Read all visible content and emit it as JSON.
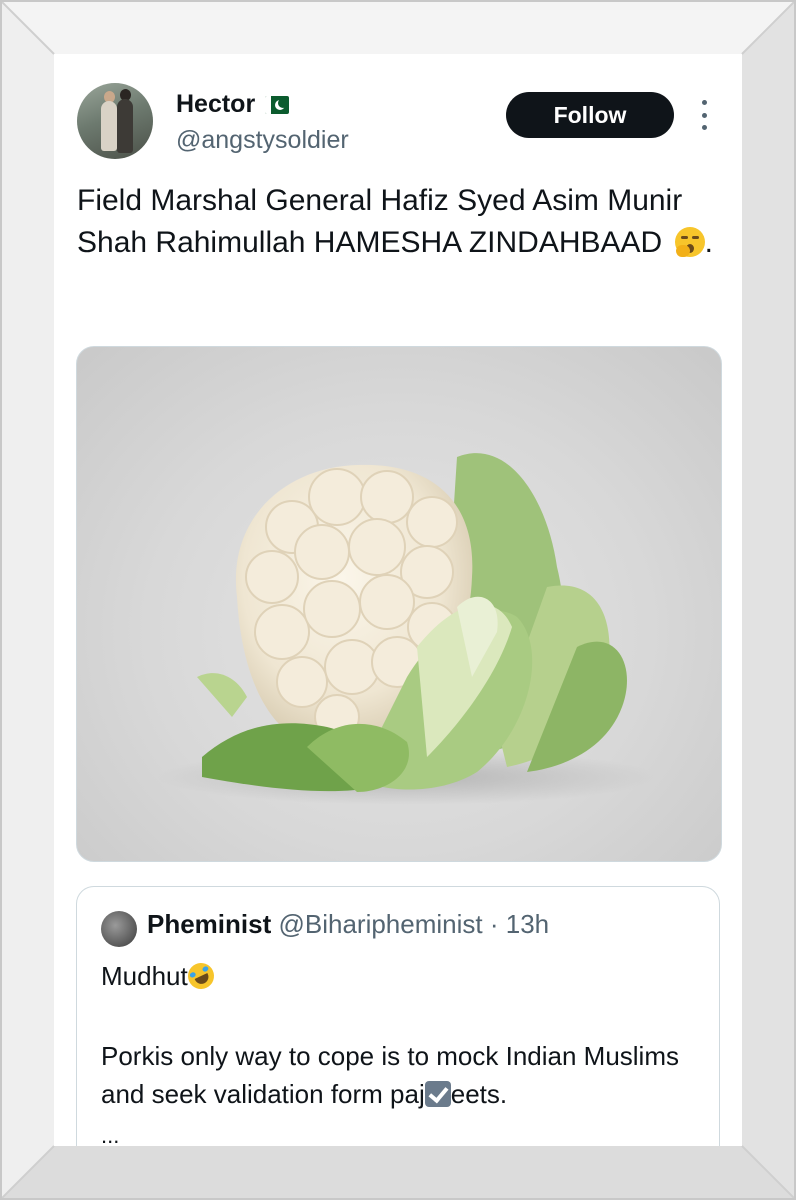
{
  "author": {
    "name": "Hector",
    "handle": "@angstysoldier",
    "flag_icon": "pakistan-flag-icon"
  },
  "follow_label": "Follow",
  "tweet": {
    "text": "Field Marshal General Hafiz Syed Asim Munir Shah Rahimullah HAMESHA ZINDAHBAAD",
    "text_suffix": ".",
    "emoji_icon": "yawning-face-icon"
  },
  "media": {
    "image_icon": "cauliflower-image"
  },
  "quoted": {
    "name": "Pheminist",
    "handle_time": "@Biharipheminist · 13h",
    "line1": "Mudhut",
    "line1_emoji_icon": "rolling-on-floor-laughing-icon",
    "body_before": "Porkis only way to cope is to mock Indian Muslims and seek validation form paj",
    "body_check_icon": "check-mark-icon",
    "body_after": "eets.",
    "more": "..."
  },
  "colors": {
    "text": "#0f1419",
    "secondary": "#536471",
    "follow_bg": "#0f1419",
    "frame": "#e9e9e9"
  }
}
